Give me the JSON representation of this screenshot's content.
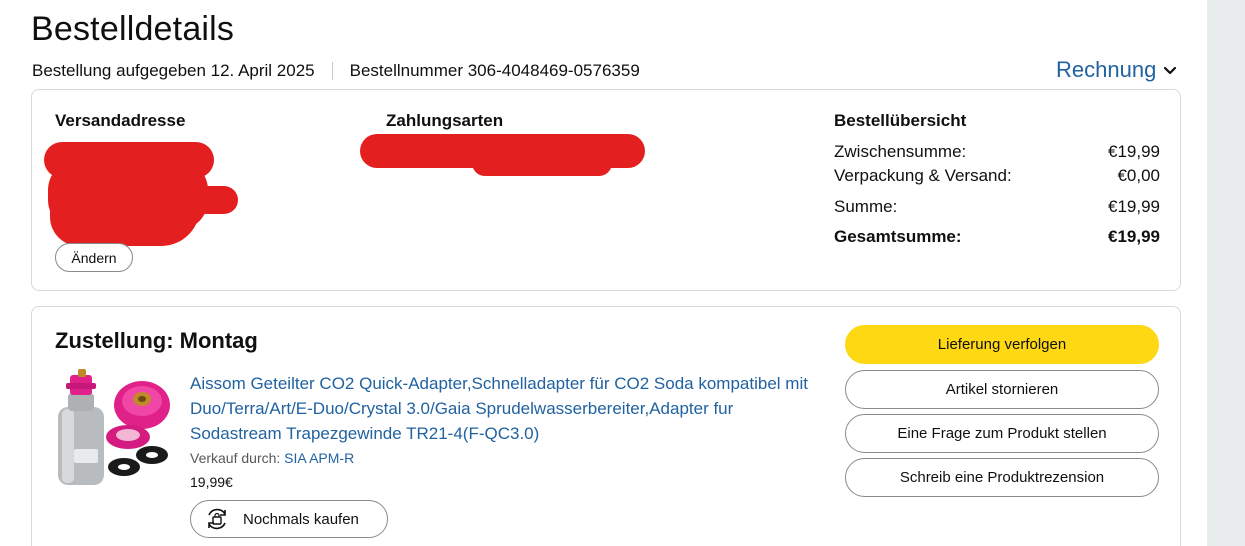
{
  "header": {
    "title": "Bestelldetails",
    "order_date": "Bestellung aufgegeben 12. April 2025",
    "order_number": "Bestellnummer 306-4048469-0576359",
    "invoice_label": "Rechnung"
  },
  "shipping": {
    "heading": "Versandadresse",
    "change_label": "Ändern"
  },
  "payment": {
    "heading": "Zahlungsarten"
  },
  "summary": {
    "heading": "Bestellübersicht",
    "rows": [
      {
        "label": "Zwischensumme:",
        "value": "€19,99"
      },
      {
        "label": "Verpackung & Versand:",
        "value": "€0,00"
      },
      {
        "label": "Summe:",
        "value": "€19,99"
      },
      {
        "label": "Gesamtsumme:",
        "value": "€19,99"
      }
    ]
  },
  "delivery": {
    "title": "Zustellung: Montag",
    "product_title": "Aissom Geteilter CO2 Quick-Adapter,Schnelladapter für CO2 Soda kompatibel mit Duo/Terra/Art/E-Duo/Crystal 3.0/Gaia Sprudelwasserbereiter,Adapter fur Sodastream Trapezgewinde TR21-4(F-QC3.0)",
    "seller_prefix": "Verkauf durch:",
    "seller_name": "SIA APM-R",
    "price": "19,99€",
    "buy_again_label": "Nochmals kaufen"
  },
  "actions": {
    "track": "Lieferung verfolgen",
    "cancel": "Artikel stornieren",
    "question": "Eine Frage zum Produkt stellen",
    "review": "Schreib eine Produktrezension"
  },
  "colors": {
    "link": "#2162a1",
    "primary_button": "#ffd814",
    "redaction": "#e41f1f",
    "border": "#d5d9d9"
  },
  "icons": {
    "invoice_dropdown": "chevron-down-icon",
    "buy_again": "reorder-icon"
  }
}
